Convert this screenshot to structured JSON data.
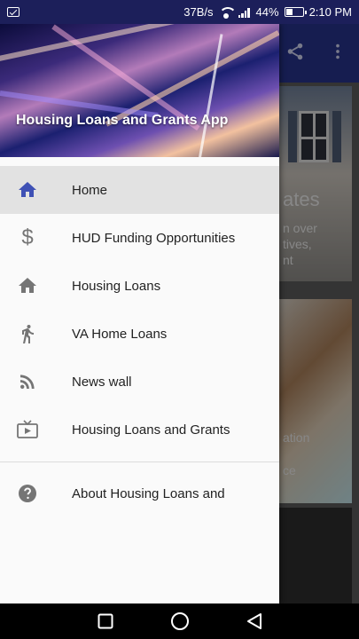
{
  "status_bar": {
    "speed": "37B/s",
    "battery_percent": "44%",
    "battery_level": 0.44,
    "time": "2:10 PM"
  },
  "background_app": {
    "toolbar_color": "#27328a",
    "toolbar_icons": [
      "share-icon",
      "more-vert-icon"
    ],
    "card_texts": [
      "ates",
      "n over",
      "tives,",
      "nt",
      "ation",
      "ce"
    ]
  },
  "drawer": {
    "header_title": "Housing Loans and Grants App",
    "items": [
      {
        "label": "Home",
        "icon": "home-icon",
        "active": true
      },
      {
        "label": "HUD Funding Opportunities",
        "icon": "dollar-icon",
        "active": false
      },
      {
        "label": "Housing Loans",
        "icon": "home-icon",
        "active": false
      },
      {
        "label": "VA Home Loans",
        "icon": "walk-icon",
        "active": false
      },
      {
        "label": "News wall",
        "icon": "rss-icon",
        "active": false
      },
      {
        "label": "Housing Loans and Grants",
        "icon": "tv-icon",
        "active": false
      }
    ],
    "secondary_items": [
      {
        "label": "About Housing Loans and",
        "icon": "help-icon"
      }
    ],
    "accent_color": "#3f51b5"
  },
  "nav_bar": {
    "buttons": [
      "recents-button",
      "home-button",
      "back-button"
    ]
  }
}
